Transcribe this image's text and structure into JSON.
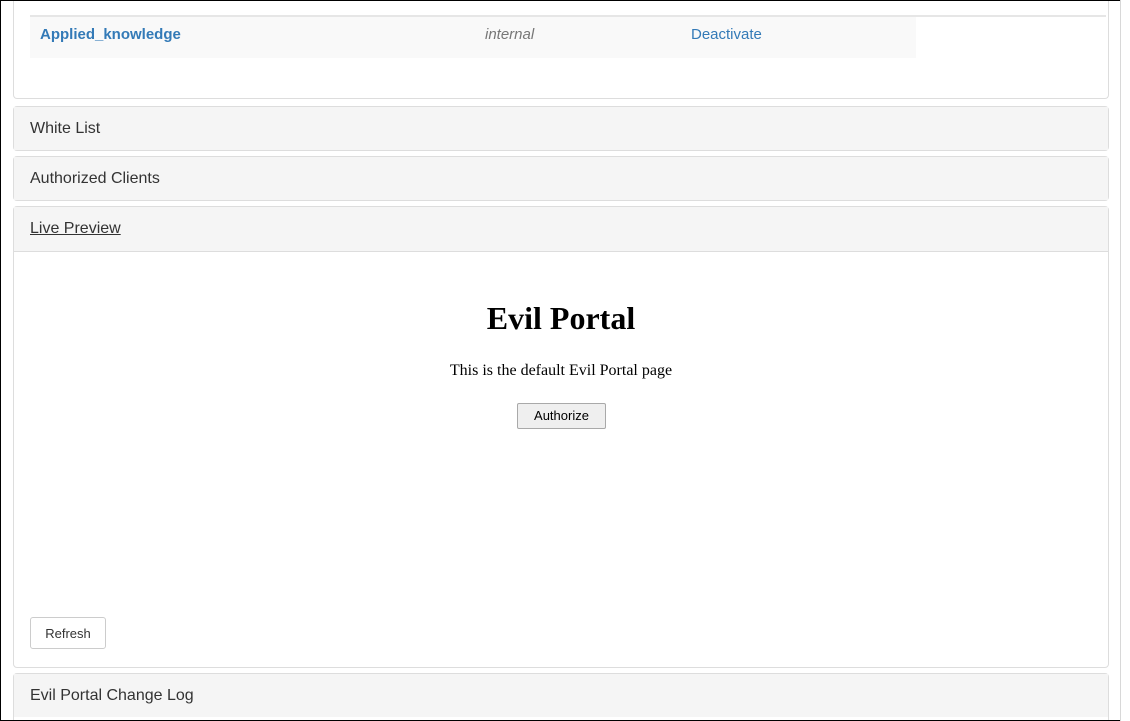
{
  "portals": {
    "rows": [
      {
        "name": "Applied_knowledge",
        "type": "internal",
        "action": "Deactivate"
      }
    ]
  },
  "panels": {
    "white_list": "White List",
    "authorized_clients": "Authorized Clients",
    "live_preview": "Live Preview",
    "change_log": "Evil Portal Change Log"
  },
  "preview": {
    "title": "Evil Portal",
    "text": "This is the default Evil Portal page",
    "authorize_label": "Authorize",
    "refresh_label": "Refresh"
  },
  "colors": {
    "link": "#337ab7",
    "heading_bg": "#f5f5f5",
    "border": "#dddddd"
  }
}
